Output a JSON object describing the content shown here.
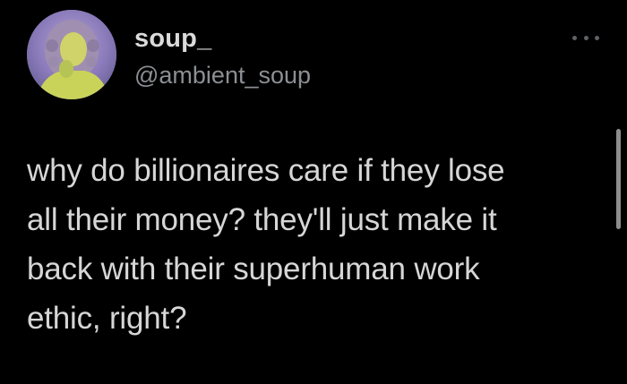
{
  "tweet": {
    "author": {
      "display_name": "soup_",
      "handle": "@ambient_soup"
    },
    "more_options_icon": "ellipsis-icon",
    "text": "why do billionaires care if they lose\nall their money? they'll just make it\nback with their superhuman work\nethic, right?"
  },
  "colors": {
    "background": "#000000",
    "display_name": "#dadada",
    "handle": "#8c8f93",
    "body_text": "#d6d6d6",
    "avatar_tint": "#9a8fc4"
  }
}
